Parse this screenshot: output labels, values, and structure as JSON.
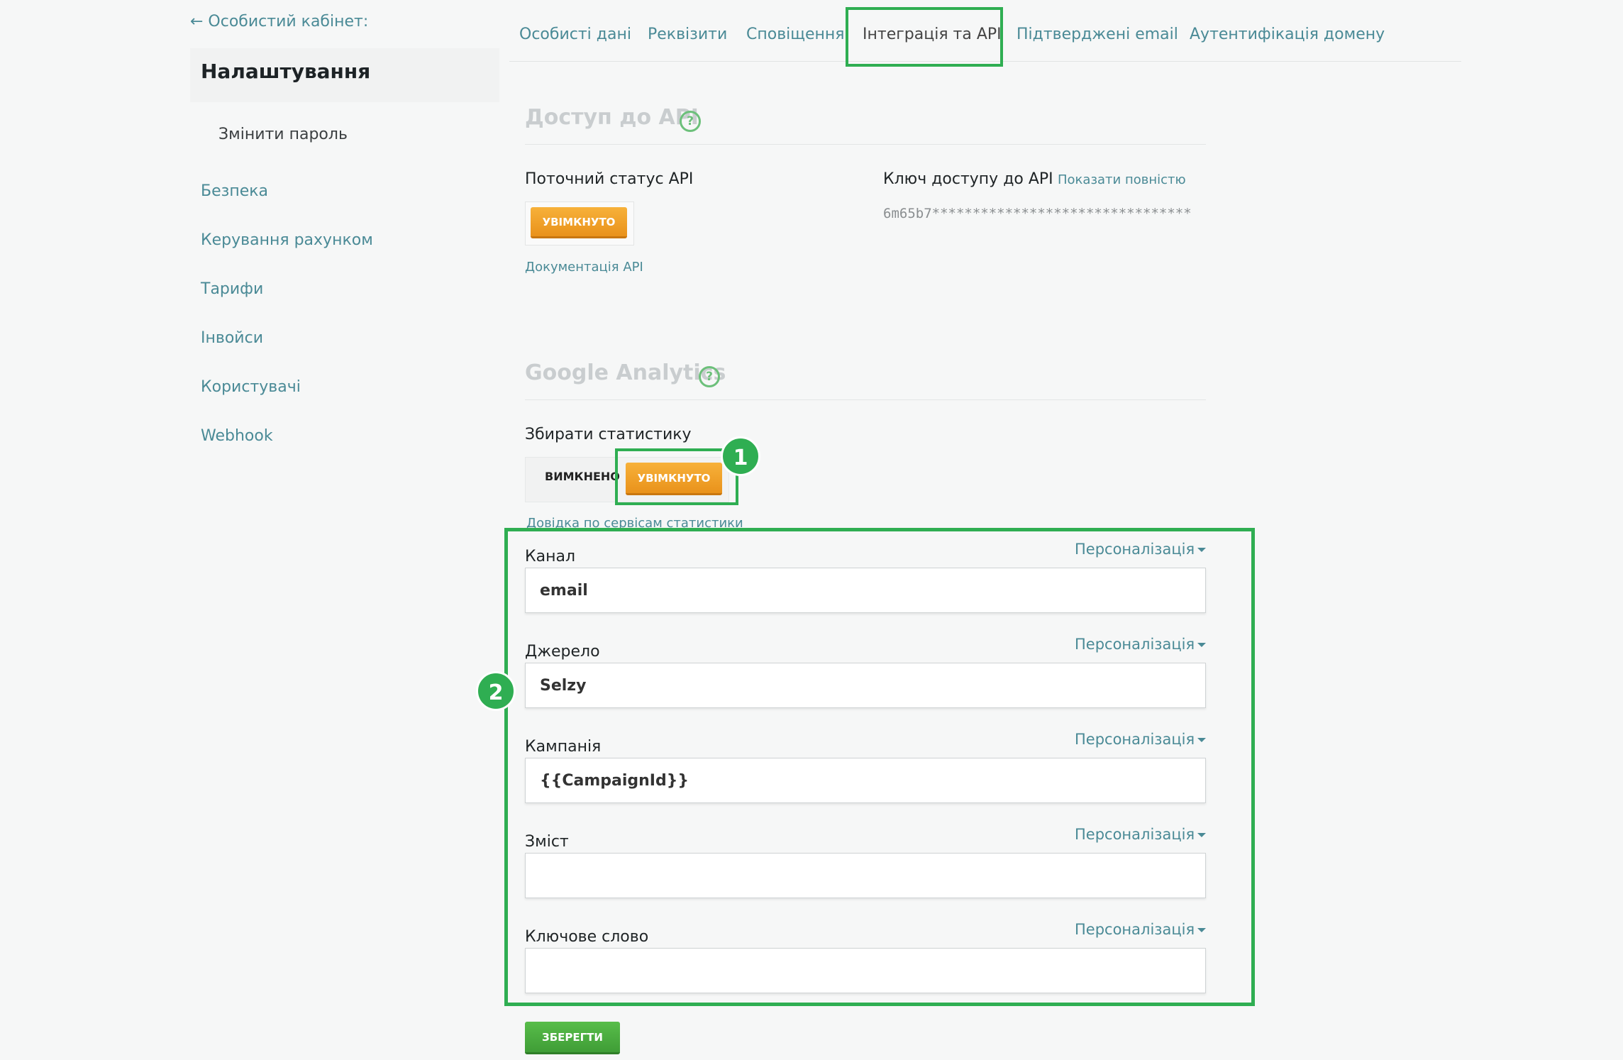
{
  "sidebar": {
    "back_link": "← Особистий кабінет:",
    "title": "Налаштування",
    "change_password": "Змінити пароль",
    "items": [
      "Безпека",
      "Керування рахунком",
      "Тарифи",
      "Інвойси",
      "Користувачі",
      "Webhook"
    ]
  },
  "tabs": [
    "Особисті дані",
    "Реквізити",
    "Сповіщення",
    "Інтеграція та API",
    "Підтверджені email",
    "Аутентифікація домену"
  ],
  "active_tab": "Інтеграція та API",
  "api": {
    "title": "Доступ до API",
    "status_label": "Поточний статус API",
    "status_value": "УВІМКНУТО",
    "docs_link": "Документація API",
    "key_label": "Ключ доступу до API",
    "show_full": "Показати повністю",
    "key_value": "6m65b7********************************"
  },
  "ga": {
    "title": "Google Analytics",
    "collect_label": "Збирати статистику",
    "toggle_off": "ВИМКНЕНО",
    "toggle_on": "УВІМКНУТО",
    "help_link": "Довідка по сервісам статистики",
    "personalization": "Персоналізація",
    "fields": [
      {
        "label": "Канал",
        "value": "email"
      },
      {
        "label": "Джерело",
        "value": "Selzy"
      },
      {
        "label": "Кампанія",
        "value": "{{CampaignId}}"
      },
      {
        "label": "Зміст",
        "value": ""
      },
      {
        "label": "Ключове слово",
        "value": ""
      }
    ],
    "save_label": "ЗБЕРЕГТИ"
  },
  "badges": [
    "1",
    "2"
  ],
  "colors": {
    "accent": "#4a8a96",
    "highlight": "#2fae52",
    "orange": "#f0a22a",
    "green_button": "#4cad40"
  }
}
